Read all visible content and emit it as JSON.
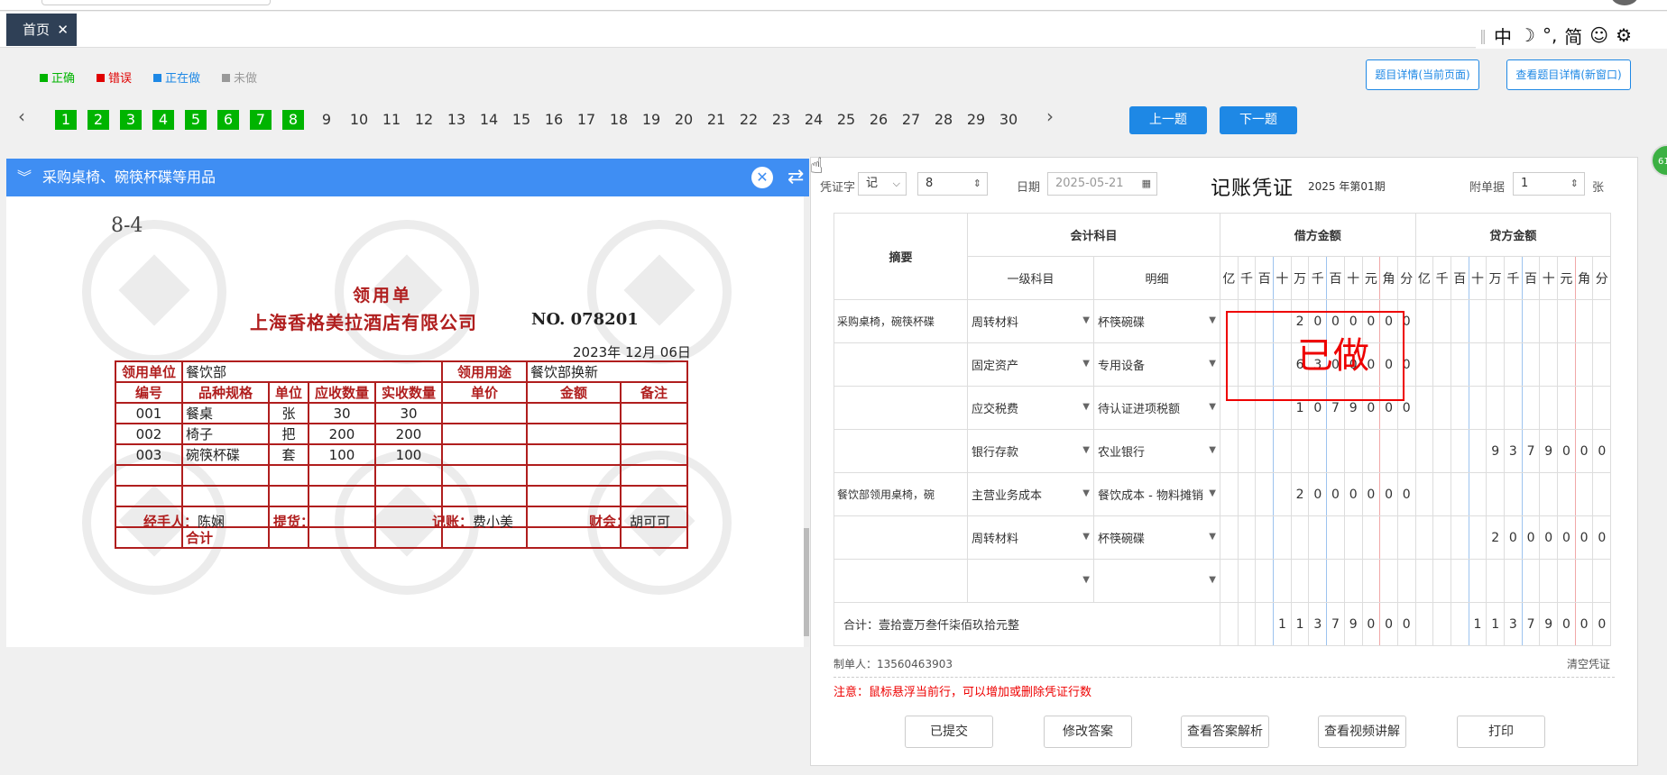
{
  "tab": {
    "label": "首页"
  },
  "toolbox": {
    "items": [
      "中",
      "☽",
      "°,",
      "简",
      "☺",
      "⚙"
    ]
  },
  "legend": [
    {
      "label": "正确",
      "color": "#00b400"
    },
    {
      "label": "错误",
      "color": "#e00000"
    },
    {
      "label": "正在做",
      "color": "#1e88e5"
    },
    {
      "label": "未做",
      "color": "#999999"
    }
  ],
  "top_buttons": {
    "detail_current": "题目详情(当前页面)",
    "detail_new": "查看题目详情(新窗口)"
  },
  "pager": {
    "pages": [
      "1",
      "2",
      "3",
      "4",
      "5",
      "6",
      "7",
      "8",
      "9",
      "10",
      "11",
      "12",
      "13",
      "14",
      "15",
      "16",
      "17",
      "18",
      "19",
      "20",
      "21",
      "22",
      "23",
      "24",
      "25",
      "26",
      "27",
      "28",
      "29",
      "30"
    ],
    "done_count": 8,
    "prev_label": "上一题",
    "next_label": "下一题"
  },
  "left": {
    "title": "采购桌椅、碗筷杯碟等用品",
    "invoice": {
      "code": "8-4",
      "title": "领用单",
      "company": "上海香格美拉酒店有限公司",
      "number": "NO. 078201",
      "date": "2023年 12月 06日",
      "unit_label": "领用单位",
      "unit_value": "餐饮部",
      "purpose_label": "领用用途",
      "purpose_value": "餐饮部换新",
      "headers": [
        "编号",
        "品种规格",
        "单位",
        "应收数量",
        "实收数量",
        "单价",
        "金额",
        "备注"
      ],
      "rows": [
        [
          "001",
          "餐桌",
          "张",
          "30",
          "30"
        ],
        [
          "002",
          "椅子",
          "把",
          "200",
          "200"
        ],
        [
          "003",
          "碗筷杯碟",
          "套",
          "100",
          "100"
        ]
      ],
      "total_label": "合计",
      "handler_label": "经手人：",
      "handler_sig": "陈娴",
      "pickup_label": "提货：",
      "book_label": "记账：",
      "book_sig": "费小美",
      "account_label": "财会：",
      "account_sig": "胡可可"
    }
  },
  "voucher": {
    "word_label": "凭证字",
    "word_value": "记",
    "number_value": "8",
    "date_label": "日期",
    "date_value": "2025-05-21",
    "title": "记账凭证",
    "period": "2025 年第01期",
    "attach_label": "附单据",
    "attach_value": "1",
    "attach_unit": "张",
    "headers": {
      "summary": "摘要",
      "account": "会计科目",
      "level1": "一级科目",
      "detail": "明细",
      "debit": "借方金额",
      "credit": "贷方金额"
    },
    "digit_units": [
      "亿",
      "千",
      "百",
      "十",
      "万",
      "千",
      "百",
      "十",
      "元",
      "角",
      "分"
    ],
    "rows": [
      {
        "summary": "采购桌椅，碗筷杯碟",
        "l1": "周转材料",
        "detail": "杯筷碗碟",
        "debit": "2000000",
        "credit": ""
      },
      {
        "summary": "",
        "l1": "固定资产",
        "detail": "专用设备",
        "debit": "6300000",
        "credit": ""
      },
      {
        "summary": "",
        "l1": "应交税费",
        "detail": "待认证进项税额",
        "debit": "1079000",
        "credit": ""
      },
      {
        "summary": "",
        "l1": "银行存款",
        "detail": "农业银行",
        "debit": "",
        "credit": "9379000"
      },
      {
        "summary": "餐饮部领用桌椅，碗",
        "l1": "主营业务成本",
        "detail": "餐饮成本 - 物料摊销",
        "debit": "2000000",
        "credit": ""
      },
      {
        "summary": "",
        "l1": "周转材料",
        "detail": "杯筷碗碟",
        "debit": "",
        "credit": "2000000"
      },
      {
        "summary": "",
        "l1": "",
        "detail": "",
        "debit": "",
        "credit": ""
      }
    ],
    "total_label": "合计：壹拾壹万叁仟柒佰玖拾元整",
    "total_debit": "11379000",
    "total_credit": "11379000",
    "stamp": "已做",
    "maker": "制单人：13560463903",
    "clear": "清空凭证",
    "note": "注意：鼠标悬浮当前行，可以增加或删除凭证行数",
    "buttons": [
      "已提交",
      "修改答案",
      "查看答案解析",
      "查看视频讲解",
      "打印"
    ]
  },
  "edge_badge": "61"
}
